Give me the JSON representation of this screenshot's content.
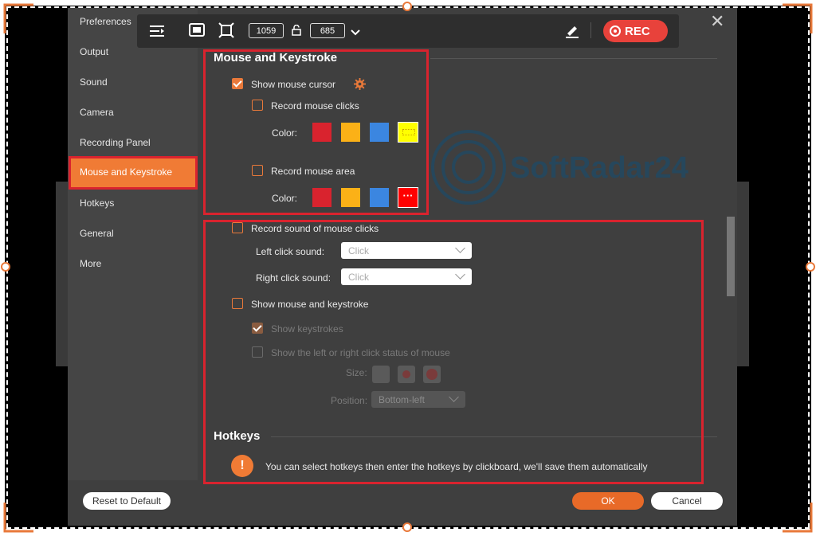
{
  "colors": {
    "accent": "#f07b35",
    "highlight_box": "#d9232e",
    "rec": "#e8423b"
  },
  "sidebar": {
    "title": "Preferences",
    "items": [
      {
        "label": "Output"
      },
      {
        "label": "Sound"
      },
      {
        "label": "Camera"
      },
      {
        "label": "Recording Panel"
      },
      {
        "label": "Mouse and Keystroke",
        "active": true
      },
      {
        "label": "Hotkeys"
      },
      {
        "label": "General"
      },
      {
        "label": "More"
      }
    ]
  },
  "toolbar": {
    "width_value": "1059",
    "height_value": "685",
    "rec_label": "REC",
    "icons": [
      "menu-icon",
      "screen-icon",
      "crop-icon",
      "unlock-icon",
      "chevron-down-icon",
      "pen-icon",
      "close-icon"
    ]
  },
  "watermark": {
    "text": "SoftRadar24"
  },
  "mouse_section": {
    "title": "Mouse and Keystroke",
    "show_cursor": {
      "label": "Show mouse cursor",
      "checked": true
    },
    "record_clicks": {
      "label": "Record mouse clicks",
      "checked": false,
      "color_label": "Color:",
      "swatch_colors": [
        "#d9232e",
        "#fbb117",
        "#3b86e0",
        "#ffff00"
      ]
    },
    "record_area": {
      "label": "Record mouse area",
      "checked": false,
      "color_label": "Color:",
      "swatch_colors": [
        "#d9232e",
        "#fbb117",
        "#3b86e0",
        "#ff0000"
      ]
    },
    "record_sound": {
      "label": "Record sound of mouse clicks",
      "checked": false
    },
    "left_click_sound": {
      "label": "Left click sound:",
      "value": "Click"
    },
    "right_click_sound": {
      "label": "Right click sound:",
      "value": "Click"
    },
    "show_mouse_keystroke": {
      "label": "Show mouse and keystroke",
      "checked": false
    },
    "show_keystrokes": {
      "label": "Show keystrokes",
      "checked": true,
      "disabled": true
    },
    "show_click_status": {
      "label": "Show the left or right click status of mouse",
      "checked": false,
      "disabled": true
    },
    "size_label": "Size:",
    "position_label": "Position:",
    "position_value": "Bottom-left"
  },
  "hotkeys_section": {
    "title": "Hotkeys",
    "info": "You can select hotkeys then enter the hotkeys by clickboard, we'll save them automatically"
  },
  "footer": {
    "reset": "Reset to Default",
    "ok": "OK",
    "cancel": "Cancel"
  }
}
